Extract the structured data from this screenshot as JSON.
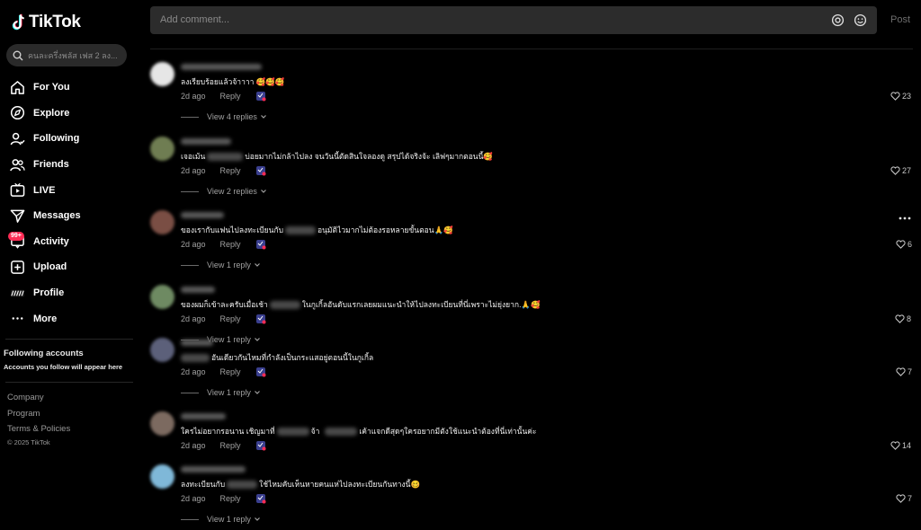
{
  "app": {
    "name": "TikTok"
  },
  "search": {
    "placeholder": "คนละครึ่งพลัส เฟส 2 ลง..."
  },
  "sidebar": {
    "items": [
      {
        "label": "For You",
        "icon": "home-icon"
      },
      {
        "label": "Explore",
        "icon": "compass-icon"
      },
      {
        "label": "Following",
        "icon": "following-icon"
      },
      {
        "label": "Friends",
        "icon": "friends-icon"
      },
      {
        "label": "LIVE",
        "icon": "live-icon"
      },
      {
        "label": "Messages",
        "icon": "messages-icon"
      },
      {
        "label": "Activity",
        "icon": "activity-icon",
        "badge": "99+"
      },
      {
        "label": "Upload",
        "icon": "upload-icon"
      },
      {
        "label": "Profile",
        "icon": "profile-avatar-icon"
      },
      {
        "label": "More",
        "icon": "more-icon"
      }
    ],
    "following_title": "Following accounts",
    "following_subtitle": "Accounts you follow will appear here",
    "footer_links": [
      "Company",
      "Program",
      "Terms & Policies"
    ],
    "copyright": "© 2025 TikTok"
  },
  "comment_box": {
    "placeholder": "Add comment...",
    "post_label": "Post"
  },
  "comments": [
    {
      "pre": "ลงเรียบร้อยแล้วจ้าาาา 🥰🥰🥰",
      "post": "",
      "time": "2d ago",
      "reply": "Reply",
      "likes": "23",
      "replies": "View 4 replies"
    },
    {
      "pre": "เจอเม้น",
      "post": "บ่อยมากไม่กล้าไปลง จนวันนี้ตัดสินใจลองดู สรุปได้จริงจ้ะ เลิฟๆมากตอนนี้🥰",
      "time": "2d ago",
      "reply": "Reply",
      "likes": "27",
      "replies": "View 2 replies"
    },
    {
      "pre": "ของเรากับแฟนไปลงทะเบียนกับ",
      "post": "อนุมัติไวมากไม่ต้องรอหลายขั้นตอน🙏🥰",
      "time": "2d ago",
      "reply": "Reply",
      "likes": "6",
      "replies": "View 1 reply"
    },
    {
      "pre": "ของผมก็เข้าละครับเมื่อเช้า",
      "post": "ในกูเกิ้ลอันดับแรกเลยผมแนะนำให้ไปลงทะเบียนที่นี่เพราะไม่ยุ่งยาก.🙏🥰",
      "time": "2d ago",
      "reply": "Reply",
      "likes": "8",
      "replies": "View 1 reply"
    },
    {
      "pre": "",
      "post": "อันเดียวกันไหมที่กำลังเป็นกระแสอยู่ตอนนี้ในกูเกิ้ล",
      "time": "2d ago",
      "reply": "Reply",
      "likes": "7",
      "replies": "View 1 reply"
    },
    {
      "pre": "ใครไม่อยากรอนาน เชิญมาที่",
      "mid": "จ้า",
      "post": "เค้าแจกดีสุดๆใครอยากมีตังใช้แนะนำต้องที่นี่เท่านั้นค่ะ",
      "time": "2d ago",
      "reply": "Reply",
      "likes": "14",
      "replies": ""
    },
    {
      "pre": "ลงทะเบียนกับ",
      "post": "ใช้ไหมคับเห็นหายคนแห่ไปลงทะเบียนกันทางนี้🥴",
      "time": "2d ago",
      "reply": "Reply",
      "likes": "7",
      "replies": "View 1 reply"
    }
  ]
}
